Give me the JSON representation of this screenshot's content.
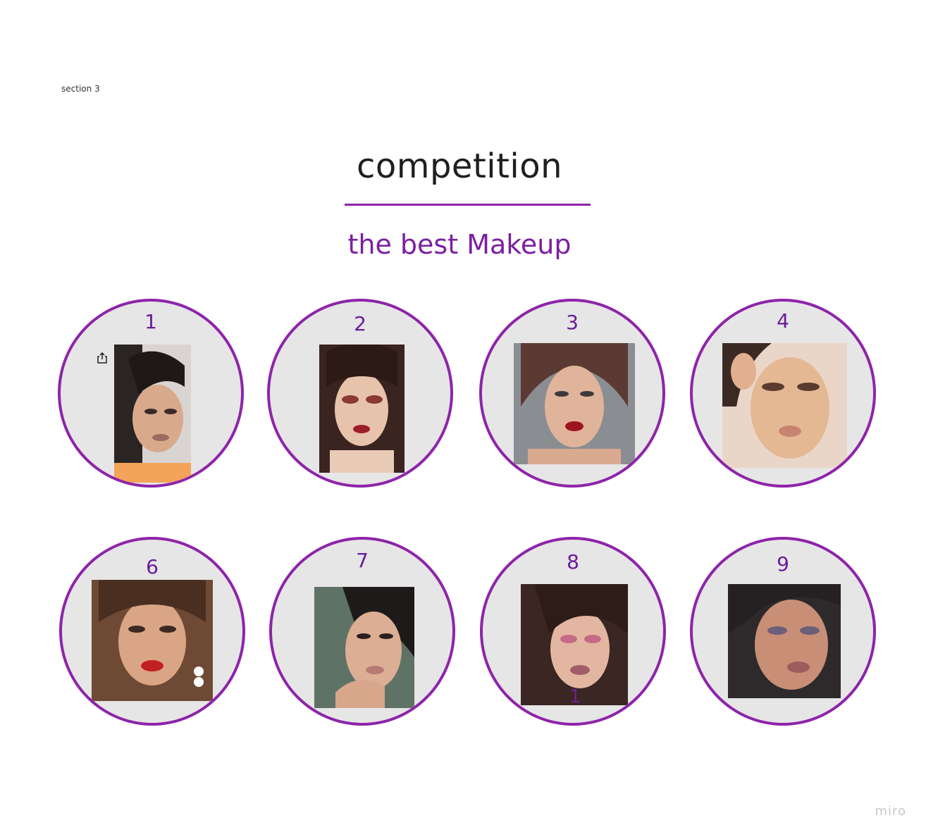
{
  "section_label": "section 3",
  "title": "competition",
  "subtitle": "the best Makeup",
  "accent_color": "#8e24aa",
  "entries": [
    {
      "number": "1",
      "photo": "makeup-photo-1"
    },
    {
      "number": "2",
      "photo": "makeup-photo-2"
    },
    {
      "number": "3",
      "photo": "makeup-photo-3"
    },
    {
      "number": "4",
      "photo": "makeup-photo-4"
    },
    {
      "number": "6",
      "photo": "makeup-photo-6"
    },
    {
      "number": "7",
      "photo": "makeup-photo-7"
    },
    {
      "number": "8",
      "photo": "makeup-photo-8"
    },
    {
      "number": "9",
      "photo": "makeup-photo-9"
    }
  ],
  "stray_number": "1",
  "share_icon": "share-icon",
  "watermark": "miro"
}
